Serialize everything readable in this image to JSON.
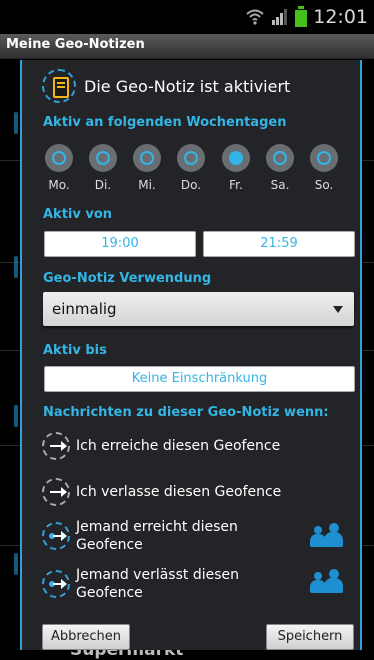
{
  "status_bar": {
    "time": "12:01",
    "icons": [
      "wifi-icon",
      "signal-icon",
      "battery-icon"
    ]
  },
  "app_title": "Meine Geo-Notizen",
  "background": {
    "partial_item_text": "Supermarkt"
  },
  "dialog": {
    "header": {
      "icon": "note-icon",
      "text": "Die Geo-Notiz ist aktiviert"
    },
    "weekdays": {
      "label": "Aktiv an folgenden Wochentagen",
      "days": [
        {
          "name": "Mo.",
          "selected": false
        },
        {
          "name": "Di.",
          "selected": false
        },
        {
          "name": "Mi.",
          "selected": false
        },
        {
          "name": "Do.",
          "selected": false
        },
        {
          "name": "Fr.",
          "selected": true
        },
        {
          "name": "Sa.",
          "selected": false
        },
        {
          "name": "So.",
          "selected": false
        }
      ]
    },
    "active_from": {
      "label": "Aktiv von",
      "start": "19:00",
      "end": "21:59"
    },
    "usage": {
      "label": "Geo-Notiz Verwendung",
      "value": "einmalig"
    },
    "active_until": {
      "label": "Aktiv bis",
      "value": "Keine Einschränkung"
    },
    "notifications": {
      "label": "Nachrichten zu dieser Geo-Notiz wenn:",
      "options": [
        {
          "text": "Ich erreiche diesen Geofence",
          "icon": "enter-geofence-icon"
        },
        {
          "text": "Ich verlasse diesen Geofence",
          "icon": "leave-geofence-icon"
        },
        {
          "text_line1": "Jemand erreicht diesen",
          "text_line2": "Geofence",
          "icon": "someone-enters-icon",
          "action_icon": "contacts-icon"
        },
        {
          "text_line1": "Jemand verlässt diesen",
          "text_line2": "Geofence",
          "icon": "someone-leaves-icon",
          "action_icon": "contacts-icon"
        }
      ]
    },
    "buttons": {
      "cancel": "Abbrechen",
      "save": "Speichern"
    }
  },
  "colors": {
    "accent": "#33b5e5",
    "dialog_bg": "#232427",
    "frame": "#33a0d8"
  }
}
